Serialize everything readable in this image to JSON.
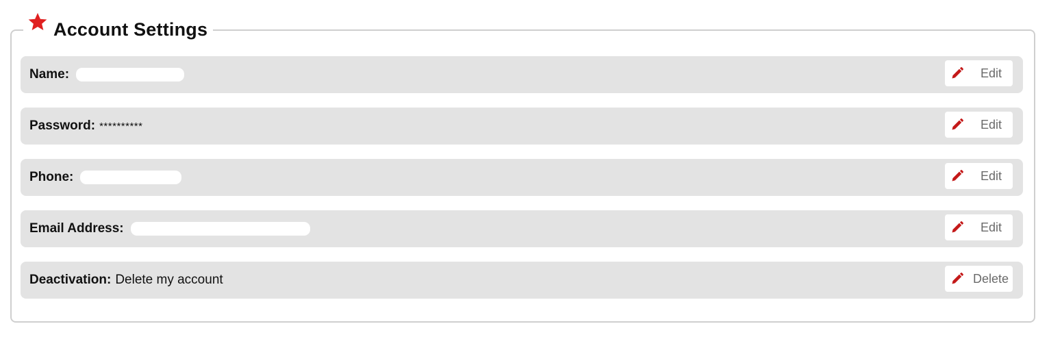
{
  "panel": {
    "title": "Account Settings",
    "title_icon": "star-icon",
    "accent_color": "#e02020"
  },
  "rows": [
    {
      "label": "Name:",
      "value": "",
      "redacted": true,
      "action": "Edit",
      "action_icon": "pencil-icon"
    },
    {
      "label": "Password:",
      "value": "**********",
      "redacted": false,
      "action": "Edit",
      "action_icon": "pencil-icon"
    },
    {
      "label": "Phone:",
      "value": "",
      "redacted": true,
      "action": "Edit",
      "action_icon": "pencil-icon"
    },
    {
      "label": "Email Address:",
      "value": "",
      "redacted": true,
      "action": "Edit",
      "action_icon": "pencil-icon"
    },
    {
      "label": "Deactivation:",
      "value": "Delete my account",
      "redacted": false,
      "action": "Delete",
      "action_icon": "pencil-icon"
    }
  ]
}
